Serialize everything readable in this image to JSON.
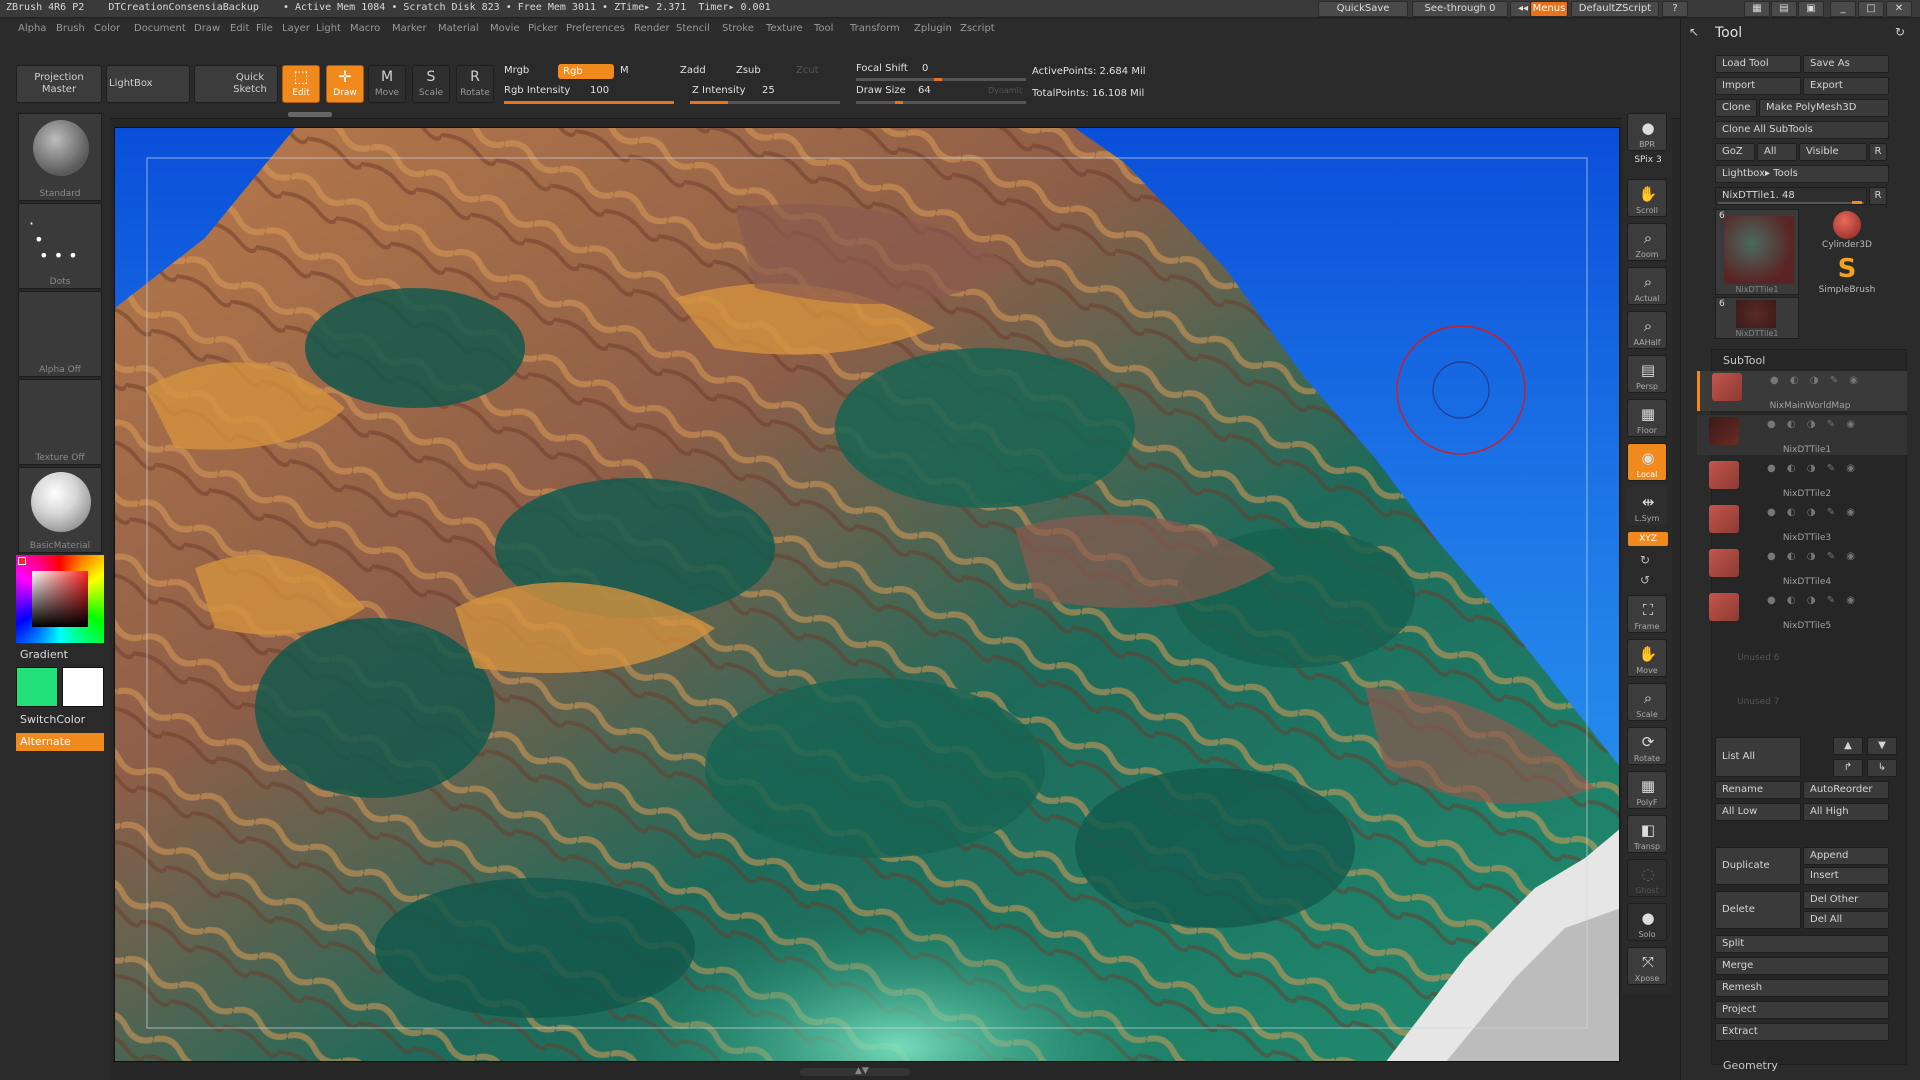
{
  "titlebar": {
    "text": "ZBrush 4R6 P2    DTCreationConsensiaBackup    • Active Mem 1084 • Scratch Disk 823 • Free Mem 3011 • ZTime▸ 2.371  Timer▸ 0.001",
    "quicksave": "QuickSave",
    "see_through": "See-through  0",
    "menus": "Menus",
    "default_zscript": "DefaultZScript"
  },
  "menubar": {
    "items": [
      "Alpha",
      "Brush",
      "Color",
      "Document",
      "Draw",
      "Edit",
      "File",
      "Layer",
      "Light",
      "Macro",
      "Marker",
      "Material",
      "Movie",
      "Picker",
      "Preferences",
      "Render",
      "Stencil",
      "Stroke",
      "Texture",
      "Tool",
      "Transform",
      "Zplugin",
      "Zscript"
    ]
  },
  "shelf": {
    "projection_master": "Projection Master",
    "lightbox": "LightBox",
    "quick_sketch": "Quick Sketch",
    "edit": "Edit",
    "draw": "Draw",
    "move": "Move",
    "scale": "Scale",
    "rotate": "Rotate",
    "mrgb": "Mrgb",
    "rgb": "Rgb",
    "m": "M",
    "rgb_intensity_label": "Rgb Intensity",
    "rgb_intensity_value": "100",
    "rgb_intensity_level": 1.0,
    "zadd": "Zadd",
    "zsub": "Zsub",
    "zcut": "Zcut",
    "z_intensity_label": "Z Intensity",
    "z_intensity_value": "25",
    "z_intensity_level": 0.25,
    "focal_shift_label": "Focal Shift",
    "focal_shift_value": "0",
    "draw_size_label": "Draw Size",
    "draw_size_value": "64",
    "dynamic": "Dynamic",
    "active_points": "ActivePoints: 2.684 Mil",
    "total_points": "TotalPoints: 16.108 Mil"
  },
  "leftshelf": {
    "brush": "Standard",
    "stroke": "Dots",
    "alpha": "Alpha  Off",
    "texture": "Texture  Off",
    "material": "BasicMaterial",
    "gradient": "Gradient",
    "switch_color": "SwitchColor",
    "alternate": "Alternate"
  },
  "righttools": {
    "bpr": "BPR",
    "spix": "SPix 3",
    "scroll": "Scroll",
    "zoom": "Zoom",
    "actual": "Actual",
    "aahalf": "AAHalf",
    "persp": "Persp",
    "floor": "Floor",
    "local": "Local",
    "lsym": "L.Sym",
    "xyz": "XYZ",
    "frame": "Frame",
    "move": "Move",
    "scale": "Scale",
    "rotate": "Rotate",
    "polyf": "PolyF",
    "transp": "Transp",
    "ghost": "Ghost",
    "solo": "Solo",
    "xpose": "Xpose"
  },
  "toolpanel": {
    "title": "Tool",
    "load_tool": "Load Tool",
    "save_as": "Save As",
    "import": "Import",
    "export": "Export",
    "clone": "Clone",
    "make_polymesh": "Make PolyMesh3D",
    "clone_all": "Clone  All SubTools",
    "goz": "GoZ",
    "all": "All",
    "visible": "Visible",
    "r": "R",
    "lightbox_tools": "Lightbox▸ Tools",
    "current_tool": "NixDTTile1. 48",
    "thumbs": [
      "NixDTTile1",
      "NixDTTile1"
    ],
    "thumb_count": [
      "6",
      "6"
    ],
    "cylinder": "Cylinder3D",
    "simplebrush": "SimpleBrush",
    "subtool_title": "SubTool",
    "subtools": [
      "NixMainWorldMap",
      "NixDTTile1",
      "NixDTTile2",
      "NixDTTile3",
      "NixDTTile4",
      "NixDTTile5"
    ],
    "unused": [
      "Unused  6",
      "Unused  7"
    ],
    "list_all": "List  All",
    "rename": "Rename",
    "autoreorder": "AutoReorder",
    "all_low": "All  Low",
    "all_high": "All  High",
    "duplicate": "Duplicate",
    "append": "Append",
    "insert": "Insert",
    "delete": "Delete",
    "del_other": "Del  Other",
    "del_all": "Del  All",
    "split": "Split",
    "merge": "Merge",
    "remesh": "Remesh",
    "project": "Project",
    "extract": "Extract",
    "geometry": "Geometry"
  },
  "colors": {
    "accent": "#f08a1c",
    "primary_color": "#22e07a",
    "secondary_color": "#ffffff"
  }
}
